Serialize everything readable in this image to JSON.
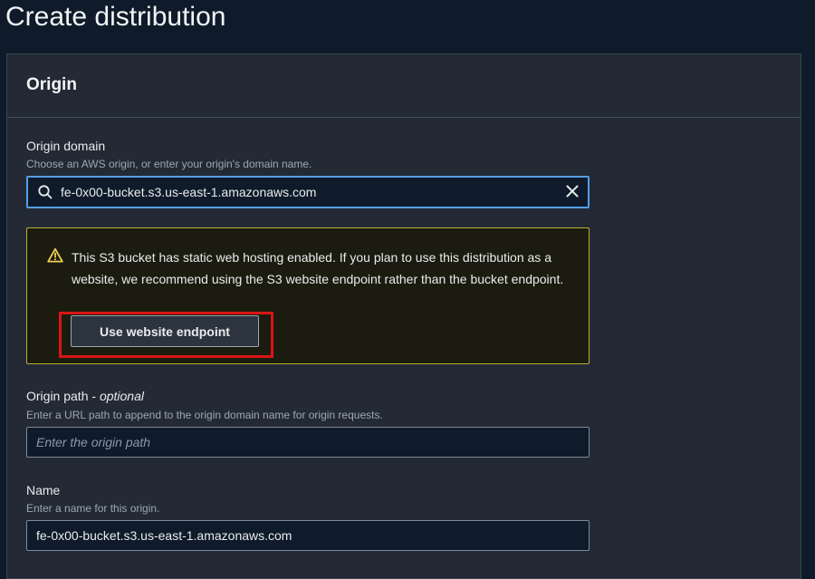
{
  "page": {
    "title": "Create distribution"
  },
  "panel": {
    "title": "Origin"
  },
  "origin_domain": {
    "label": "Origin domain",
    "description": "Choose an AWS origin, or enter your origin's domain name.",
    "value": "fe-0x00-bucket.s3.us-east-1.amazonaws.com",
    "icon": "search-icon",
    "clear_icon": "close-icon"
  },
  "alert": {
    "type": "warning",
    "icon": "warning-icon",
    "message": "This S3 bucket has static web hosting enabled. If you plan to use this distribution as a website, we recommend using the S3 website endpoint rather than the bucket endpoint.",
    "button_label": "Use website endpoint",
    "border_color": "#bdac31",
    "highlight_color": "#d91515"
  },
  "origin_path": {
    "label": "Origin path",
    "label_suffix": "optional",
    "description": "Enter a URL path to append to the origin domain name for origin requests.",
    "placeholder": "Enter the origin path",
    "value": ""
  },
  "name_field": {
    "label": "Name",
    "description": "Enter a name for this origin.",
    "value": "fe-0x00-bucket.s3.us-east-1.amazonaws.com"
  },
  "colors": {
    "focus": "#539fe5",
    "background": "#0f1b2a",
    "panel": "#232a35"
  }
}
